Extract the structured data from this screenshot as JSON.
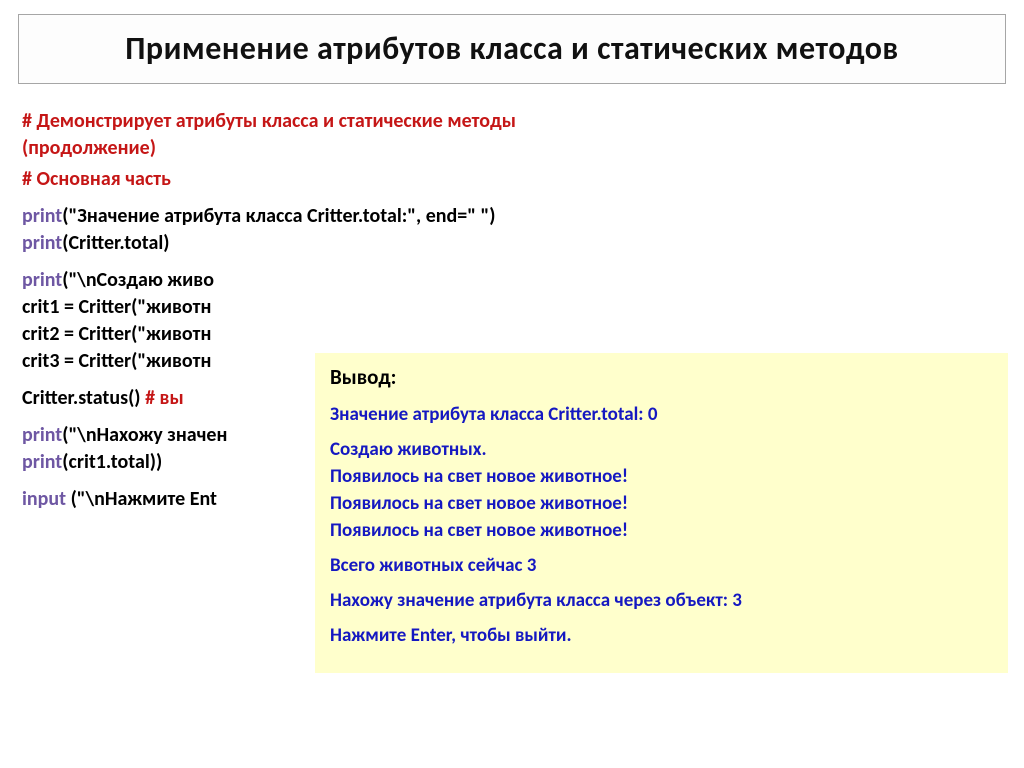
{
  "title": "Применение  атрибутов  класса  и  статических    методов",
  "code": {
    "c1_a": "#  Демонстрирует  атрибуты  класса  и  статические  методы",
    "c1_b": "(продолжение)",
    "c2": "#  Основная  часть",
    "l1_kw": "print",
    "l1_rest": "(\"Значение  атрибута  класса  Critter.total:\",  end=\"  \")",
    "l2_kw": "print",
    "l2_rest": "(Critter.total)",
    "l3_kw": "print",
    "l3_rest": "(\"\\nСоздаю   живо",
    "l4": "crit1  =  Critter(\"животн",
    "l5": "crit2  =  Critter(\"животн",
    "l6": "crit3  =  Critter(\"животн",
    "l7_a": "Critter.status()        ",
    "l7_b": "#  вы",
    "l8_kw": "print",
    "l8_rest": "(\"\\nНахожу  значен",
    "l9_kw": "print",
    "l9_rest": "(crit1.total))",
    "l10_kw": "input",
    "l10_rest": " (\"\\nНажмите  Ent"
  },
  "output": {
    "header": "Вывод:",
    "o1": "Значение  атрибута  класса  Critter.total:   0",
    "o2": "Создаю  животных.",
    "o3": "Появилось  на  свет  новое  животное!",
    "o4": "Появилось  на  свет  новое  животное!",
    "o5": "Появилось  на  свет  новое  животное!",
    "o6": "Всего  животных  сейчас  3",
    "o7": "Нахожу  значение  атрибута  класса  через  объект:   3",
    "o8": "Нажмите  Enter,  чтобы  выйти."
  }
}
